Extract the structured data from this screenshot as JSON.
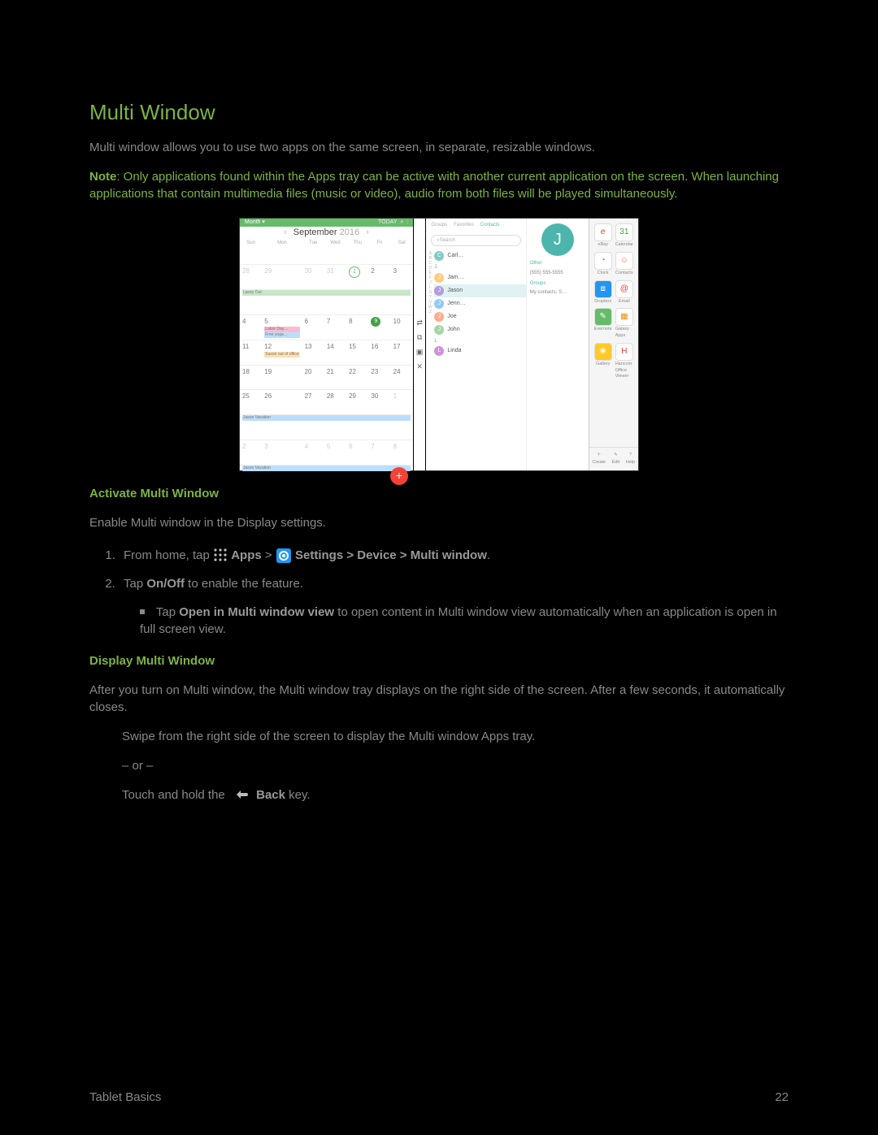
{
  "title": "Multi Window",
  "intro": "Multi window allows you to use two apps on the same screen, in separate, resizable windows.",
  "note_label": "Note",
  "note_body": ": Only applications found within the Apps tray can be active with another current application on the screen. When launching applications that contain multimedia files (music or video), audio from both files will be played simultaneously.",
  "section1_title": "Activate Multi Window",
  "section1_lead": "Enable Multi window in the Display settings.",
  "step1_pre": "From home, tap ",
  "step1_apps": "Apps",
  "step1_gt1": " > ",
  "step1_settings": "Settings > Device > Multi window",
  "step1_post": ".",
  "step2_pre": "Tap ",
  "step2_onoff": "On/Off",
  "step2_post": " to enable the feature.",
  "sub_pre": "Tap ",
  "sub_bold": "Open in Multi window view",
  "sub_post": " to open content in Multi window view automatically when an application is open in full screen view.",
  "section2_title": "Display Multi Window",
  "section2_lead": "After you turn on Multi window, the Multi window tray displays on the right side of the screen. After a few seconds, it automatically closes.",
  "swipe_line": "Swipe from the right side of the screen to display the Multi window Apps tray.",
  "or_line": "– or –",
  "touch_pre": "Touch and hold the ",
  "touch_back": "Back",
  "touch_post": " key.",
  "footer_left": "Tablet Basics",
  "footer_right": "22",
  "shot": {
    "cal_view": "Month",
    "cal_today": "TODAY",
    "cal_title_month": "September",
    "cal_title_year": "2016",
    "weekdays": [
      "Sun",
      "Mon",
      "Tue",
      "Wed",
      "Thu",
      "Fri",
      "Sat"
    ],
    "ev_lacey": "Lacey Out",
    "ev_labor": "Labor Day…",
    "ev_yoga": "Free yoga…",
    "ev_susan": "Susan out of office",
    "ev_jason": "Jason Vacation",
    "contacts_tabs": {
      "groups": "Groups",
      "favorites": "Favorites",
      "contacts": "Contacts"
    },
    "search_placeholder": "Search",
    "contacts": [
      {
        "initial": "C",
        "name": "Carl…",
        "c": "#80cbc4"
      },
      {
        "section": "J"
      },
      {
        "initial": "J",
        "name": "Jam…",
        "c": "#ffcc80"
      },
      {
        "initial": "J",
        "name": "Jason",
        "c": "#b39ddb",
        "sel": true
      },
      {
        "initial": "J",
        "name": "Jenn…",
        "c": "#90caf9"
      },
      {
        "initial": "J",
        "name": "Joe",
        "c": "#ffab91"
      },
      {
        "initial": "J",
        "name": "John",
        "c": "#a5d6a7"
      },
      {
        "section": "L"
      },
      {
        "initial": "L",
        "name": "Linda",
        "c": "#ce93d8"
      }
    ],
    "card_other": "Other",
    "card_phone": "(555) 555-5555",
    "card_groups_label": "Groups",
    "card_groups_val": "My contacts, S…",
    "tray_apps": [
      {
        "n": "eBay",
        "c": "#fff",
        "t": "e",
        "tc": "#e53935"
      },
      {
        "n": "Calendar",
        "c": "#fff",
        "t": "31",
        "tc": "#43a047"
      },
      {
        "n": "Clock",
        "c": "#fff",
        "t": "◔",
        "tc": "#888"
      },
      {
        "n": "Contacts",
        "c": "#fff",
        "t": "☺",
        "tc": "#ff7043"
      },
      {
        "n": "Dropbox",
        "c": "#2196f3",
        "t": "⧈",
        "tc": "#fff"
      },
      {
        "n": "Email",
        "c": "#fff",
        "t": "@",
        "tc": "#e53935"
      },
      {
        "n": "Evernote",
        "c": "#66bb6a",
        "t": "✎",
        "tc": "#fff"
      },
      {
        "n": "Galaxy Apps",
        "c": "#fff",
        "t": "▦",
        "tc": "#fb8c00"
      },
      {
        "n": "Gallery",
        "c": "#ffca28",
        "t": "❀",
        "tc": "#fff"
      },
      {
        "n": "Hancom Office Viewer",
        "c": "#fff",
        "t": "H",
        "tc": "#e53935"
      }
    ],
    "tray_bottom": {
      "create": "Create",
      "edit": "Edit",
      "help": "Help"
    }
  }
}
